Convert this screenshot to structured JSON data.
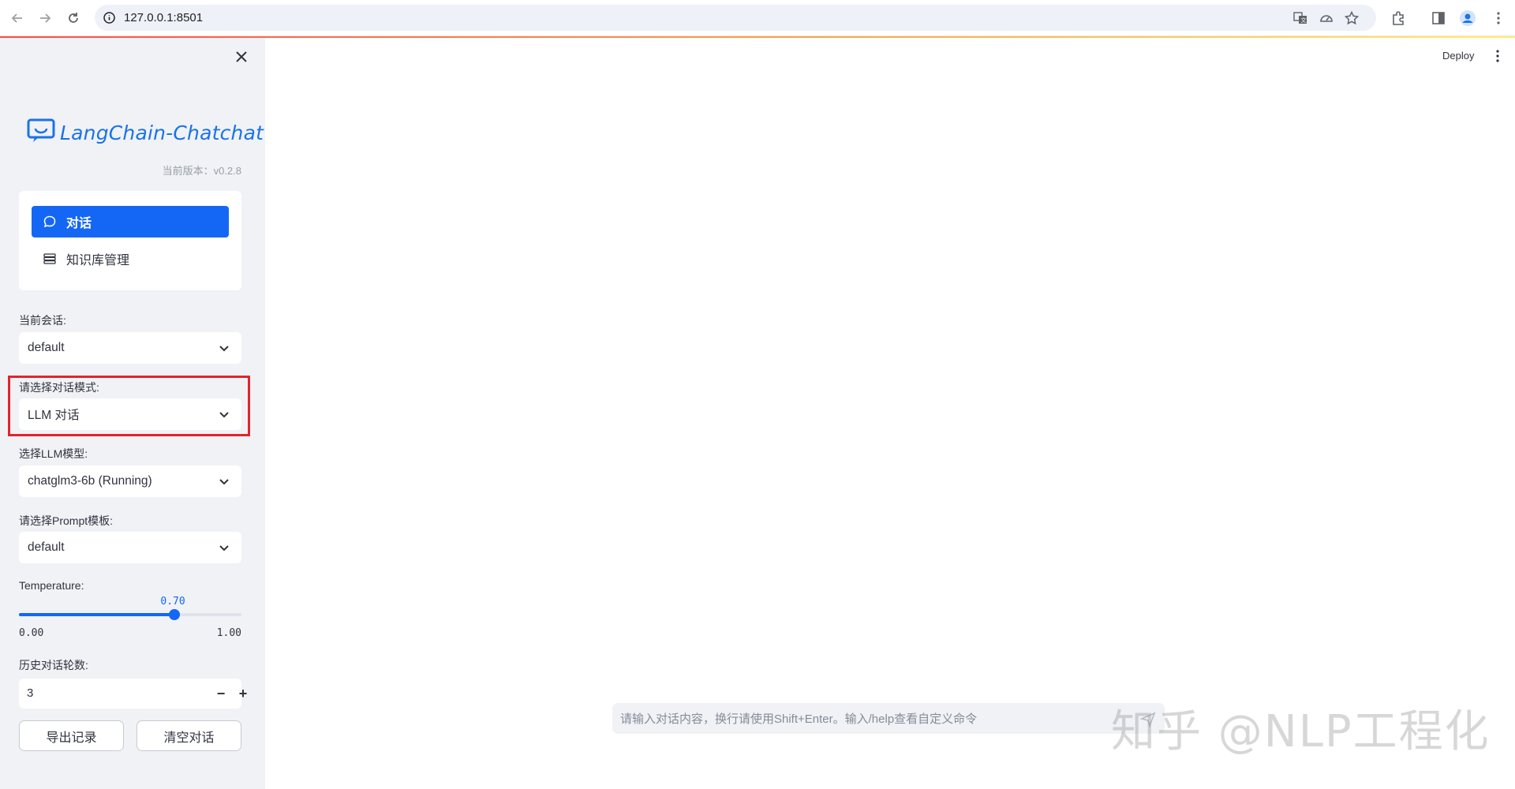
{
  "browser": {
    "url": "127.0.0.1:8501",
    "icons": [
      "back-icon",
      "forward-icon",
      "reload-icon",
      "info-icon",
      "translate-icon",
      "performance-icon",
      "star-icon",
      "extensions-icon",
      "side-panel-icon",
      "profile-icon",
      "chrome-menu-icon"
    ]
  },
  "sidebar": {
    "app_name": "LangChain-Chatchat",
    "version": "当前版本：v0.2.8",
    "menu": [
      {
        "label": "对话",
        "icon": "chat-bubble-icon",
        "active": true
      },
      {
        "label": "知识库管理",
        "icon": "database-icon",
        "active": false
      }
    ],
    "session": {
      "label": "当前会话:",
      "value": "default"
    },
    "dialogue_mode": {
      "label": "请选择对话模式:",
      "value": "LLM 对话"
    },
    "llm_model": {
      "label": "选择LLM模型:",
      "value": "chatglm3-6b (Running)"
    },
    "prompt_template": {
      "label": "请选择Prompt模板:",
      "value": "default"
    },
    "temperature": {
      "label": "Temperature:",
      "value": "0.70",
      "min": "0.00",
      "max": "1.00",
      "fraction": 0.7
    },
    "history_rounds": {
      "label": "历史对话轮数:",
      "value": "3",
      "minus": "−",
      "plus": "+"
    },
    "export_button": "导出记录",
    "clear_button": "清空对话"
  },
  "main": {
    "deploy_label": "Deploy",
    "chat_placeholder": "请输入对话内容，换行请使用Shift+Enter。输入/help查看自定义命令",
    "watermark": "知乎 @NLP工程化"
  },
  "colors": {
    "accent": "#1467f5",
    "highlight": "#e1252d",
    "sidebar_bg": "#f0f2f6"
  }
}
